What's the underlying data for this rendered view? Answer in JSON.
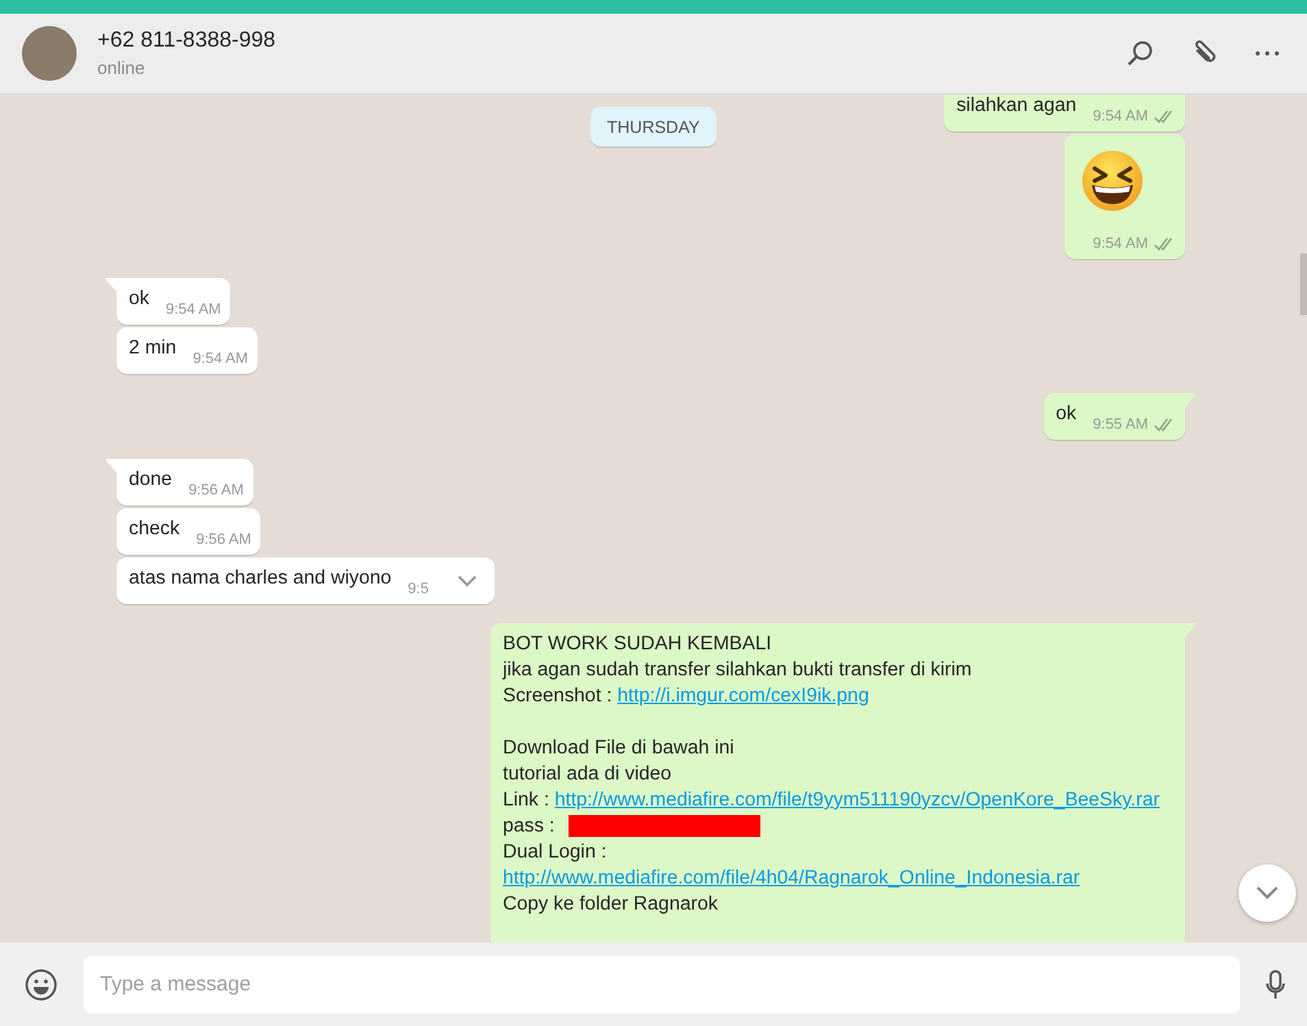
{
  "header": {
    "name": "+62 811-8388-998",
    "status": "online"
  },
  "date_label": "THURSDAY",
  "messages": [
    {
      "kind": "out",
      "tail": false,
      "text": "silahkan agan",
      "time": "9:54 AM"
    },
    {
      "kind": "emoji",
      "tail": false,
      "time": "9:54 AM"
    },
    {
      "kind": "in",
      "tail": true,
      "text": "ok",
      "time": "9:54 AM"
    },
    {
      "kind": "in",
      "tail": false,
      "text": "2 min",
      "time": "9:54 AM"
    },
    {
      "kind": "out",
      "tail": true,
      "text": "ok",
      "time": "9:55 AM"
    },
    {
      "kind": "in",
      "tail": true,
      "text": "done",
      "time": "9:56 AM"
    },
    {
      "kind": "in",
      "tail": false,
      "text": "check",
      "time": "9:56 AM"
    },
    {
      "kind": "in",
      "tail": false,
      "text": "atas nama charles and wiyono",
      "time": "9:5",
      "menu": true
    },
    {
      "kind": "long",
      "tail": true,
      "lines": [
        {
          "kind": "text",
          "text": "BOT WORK SUDAH KEMBALI"
        },
        {
          "kind": "text",
          "text": "jika agan sudah transfer silahkan bukti transfer di kirim"
        },
        {
          "kind": "text",
          "text": "Screenshot : ",
          "link": "http://i.imgur.com/cexI9ik.png"
        },
        {
          "kind": "gap"
        },
        {
          "kind": "text",
          "text": "Download File di bawah ini"
        },
        {
          "kind": "text",
          "text": "tutorial ada di video"
        },
        {
          "kind": "text",
          "text": "Link : ",
          "link": "http://www.mediafire.com/file/t9yym511190yzcv/OpenKore_BeeSky.rar"
        },
        {
          "kind": "text",
          "text": "pass :",
          "redacted": true
        },
        {
          "kind": "text",
          "text": "Dual Login :"
        },
        {
          "kind": "link",
          "link": "http://www.mediafire.com/file/4h04/Ragnarok_Online_Indonesia.rar"
        },
        {
          "kind": "text",
          "text": "Copy ke folder Ragnarok"
        },
        {
          "kind": "gap"
        }
      ]
    }
  ],
  "composer": {
    "placeholder": "Type a message"
  }
}
